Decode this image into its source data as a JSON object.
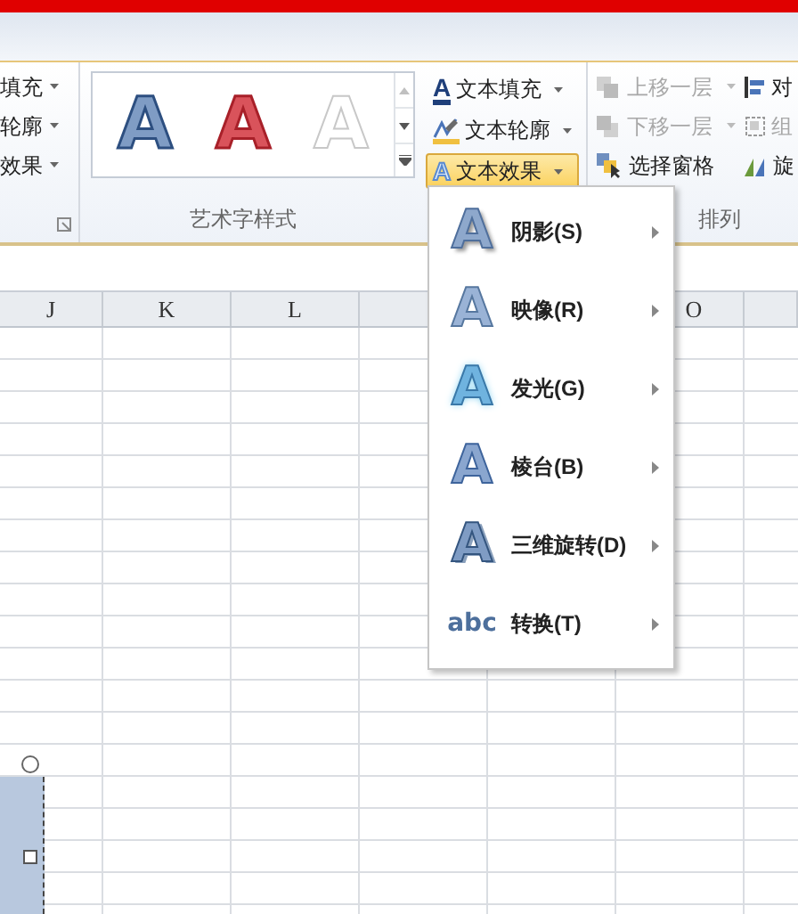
{
  "ribbon": {
    "left_group": {
      "items": [
        {
          "label": "填充"
        },
        {
          "label": "轮廓"
        },
        {
          "label": "效果"
        }
      ]
    },
    "wordart_group": {
      "label": "艺术字样式",
      "styles": [
        {
          "kind": "blue",
          "sample": "A"
        },
        {
          "kind": "red",
          "sample": "A"
        },
        {
          "kind": "white",
          "sample": "A"
        }
      ],
      "text_buttons": [
        {
          "kind": "fill",
          "icon_text": "A",
          "label": "文本填充",
          "selected": false
        },
        {
          "kind": "outline",
          "label": "文本轮廓",
          "selected": false
        },
        {
          "kind": "effects",
          "icon_text": "A",
          "label": "文本效果",
          "selected": true
        }
      ]
    },
    "arrange_group": {
      "label": "排列",
      "items": [
        {
          "kind": "forward",
          "label": "上移一层",
          "disabled": true
        },
        {
          "kind": "backward",
          "label": "下移一层",
          "disabled": true
        },
        {
          "kind": "pane",
          "label": "选择窗格",
          "disabled": false
        }
      ],
      "cut_items": [
        {
          "kind": "align",
          "label": "对",
          "disabled": false
        },
        {
          "kind": "group",
          "label": "组",
          "disabled": true
        },
        {
          "kind": "rotate",
          "label": "旋",
          "disabled": false
        }
      ]
    }
  },
  "sheet": {
    "columns": [
      "J",
      "K",
      "L",
      "O"
    ]
  },
  "menu": {
    "items": [
      {
        "kind": "shadow",
        "icon_text": "A",
        "label": "阴影(S)"
      },
      {
        "kind": "reflection",
        "icon_text": "A",
        "label": "映像(R)"
      },
      {
        "kind": "glow",
        "icon_text": "A",
        "label": "发光(G)"
      },
      {
        "kind": "bevel",
        "icon_text": "A",
        "label": "棱台(B)"
      },
      {
        "kind": "rotation",
        "icon_text": "A",
        "label": "三维旋转(D)"
      },
      {
        "kind": "transform",
        "icon_text": "abc",
        "label": "转换(T)"
      }
    ]
  }
}
